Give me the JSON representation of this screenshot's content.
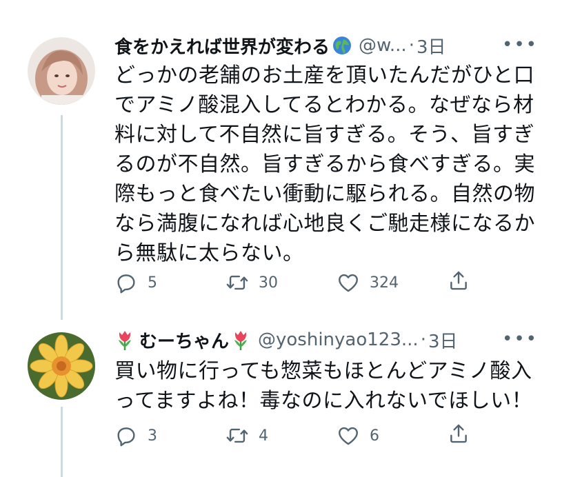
{
  "tweets": [
    {
      "display_name": "食をかえれば世界が変わる",
      "handle": "@w...",
      "separator": "·",
      "time": "3日",
      "more": "•••",
      "text": "どっかの老舗のお土産を頂いたんだがひと口でアミノ酸混入してるとわかる。なぜなら材料に対して不自然に旨すぎる。そう、旨すぎるのが不自然。旨すぎるから食べすぎる。実際もっと食べたい衝動に駆られる。自然の物なら満腹になれば心地良くご馳走様になるから無駄に太らない。",
      "replies": "5",
      "retweets": "30",
      "likes": "324"
    },
    {
      "display_name": "むーちゃん",
      "handle": "@yoshinyao123...",
      "separator": "·",
      "time": "3日",
      "more": "•••",
      "text": "買い物に行っても惣菜もほとんどアミノ酸入ってますよね！毒なのに入れないでほしい！",
      "replies": "3",
      "retweets": "4",
      "likes": "6"
    }
  ],
  "icons": {
    "reply": "reply-icon",
    "retweet": "retweet-icon",
    "like": "heart-icon",
    "share": "share-icon",
    "globe": "globe-emoji",
    "tulip": "tulip-emoji"
  },
  "colors": {
    "text": "#0f1419",
    "secondary": "#536471",
    "thread_line": "#cfd9de"
  }
}
